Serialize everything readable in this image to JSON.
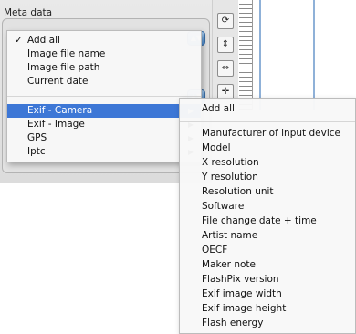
{
  "panel": {
    "title": "Meta data"
  },
  "menu": {
    "group1": [
      {
        "label": "Add all",
        "checked": true
      },
      {
        "label": "Image file name",
        "checked": false
      },
      {
        "label": "Image file path",
        "checked": false
      },
      {
        "label": "Current date",
        "checked": false
      }
    ],
    "group2": [
      {
        "label": "Exif - Camera",
        "highlighted": true
      },
      {
        "label": "Exif - Image",
        "highlighted": false
      },
      {
        "label": "GPS",
        "highlighted": false
      },
      {
        "label": "Iptc",
        "highlighted": false
      }
    ],
    "check_glyph": "✓",
    "submenu_glyph": "▶"
  },
  "submenu": {
    "top_item": "Add all",
    "items": [
      "Manufacturer of input device",
      "Model",
      "X resolution",
      "Y resolution",
      "Resolution unit",
      "Software",
      "File change date + time",
      "Artist name",
      "OECF",
      "Maker note",
      "FlashPix version",
      "Exif image width",
      "Exif image height",
      "Flash energy"
    ]
  },
  "colors": {
    "highlight": "#3d77d6",
    "popup_button": "#4c8fd6"
  },
  "icons": [
    "rotate-icon",
    "fit-vertical-icon",
    "fit-horizontal-icon",
    "center-icon"
  ]
}
